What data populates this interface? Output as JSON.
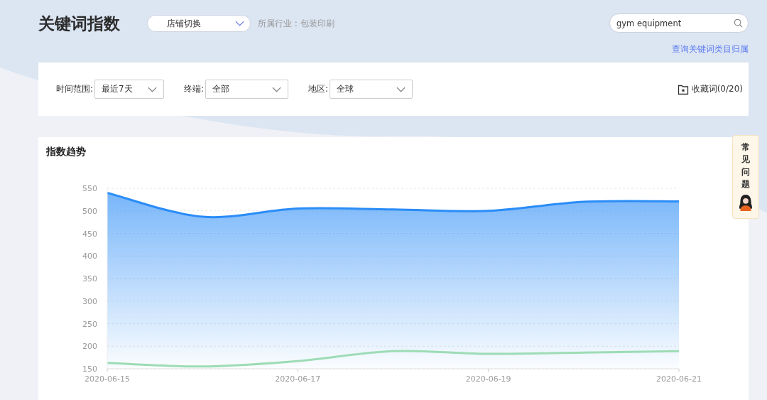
{
  "header": {
    "title": "关键词指数",
    "shop_switch": "店铺切换",
    "industry": "所属行业 : 包装印刷",
    "search": {
      "value": "gym equipment"
    },
    "category_link": "查询关键词类目归属"
  },
  "filters": [
    {
      "label": "时间范围:",
      "value": "最近7天"
    },
    {
      "label": "终端:",
      "value": "全部"
    },
    {
      "label": "地区:",
      "value": "全球"
    }
  ],
  "favorites": "收藏词(0/20)",
  "trend": {
    "title": "指数趋势",
    "chart_data": {
      "type": "line",
      "grid": true,
      "categories": [
        "2020-06-15",
        null,
        "2020-06-17",
        null,
        "2020-06-19",
        null,
        "2020-06-21"
      ],
      "ylim": [
        150,
        550
      ],
      "yticks": [
        150,
        200,
        250,
        300,
        350,
        400,
        450,
        500,
        550
      ],
      "series": [
        {
          "type": "area",
          "color": "#2a8cf7",
          "values": [
            540,
            487,
            505,
            503,
            500,
            520,
            521
          ]
        },
        {
          "color": "#9ddcb5",
          "values": [
            163,
            155,
            167,
            189,
            183,
            186,
            189
          ]
        }
      ]
    }
  },
  "faq": {
    "label": "常见问题"
  }
}
